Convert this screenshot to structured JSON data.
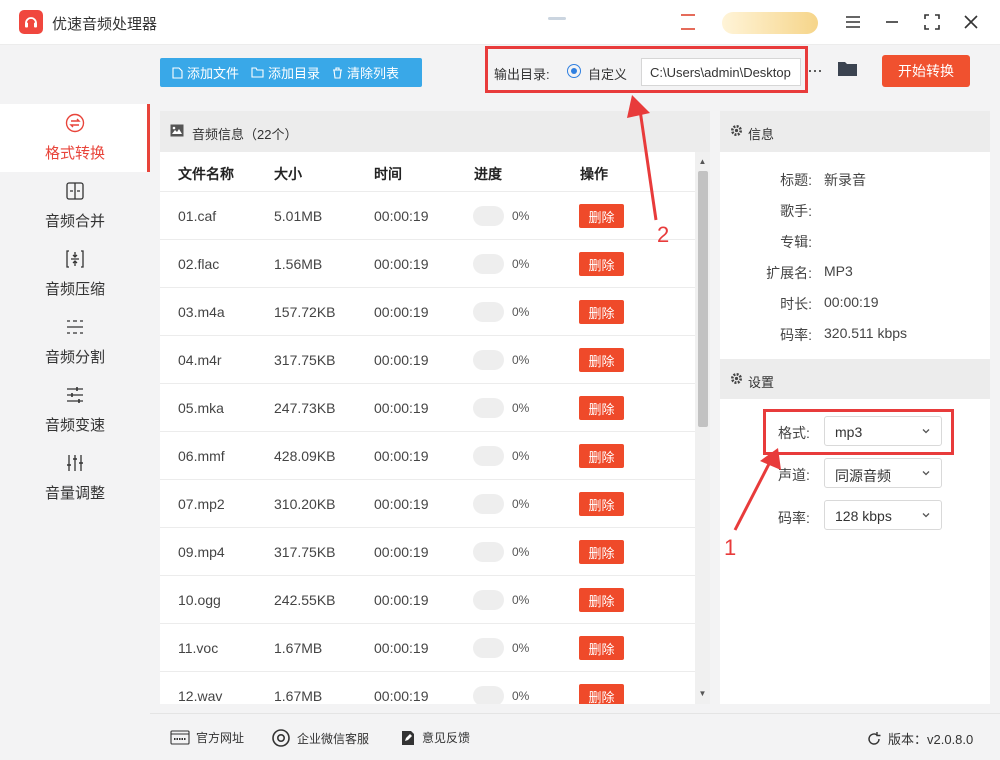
{
  "app": {
    "title": "优速音频处理器"
  },
  "sidebar": {
    "items": [
      {
        "label": "格式转换",
        "icon": "swap-icon",
        "active": true
      },
      {
        "label": "音频合并",
        "icon": "merge-icon",
        "active": false
      },
      {
        "label": "音频压缩",
        "icon": "compress-icon",
        "active": false
      },
      {
        "label": "音频分割",
        "icon": "split-icon",
        "active": false
      },
      {
        "label": "音频变速",
        "icon": "speed-icon",
        "active": false
      },
      {
        "label": "音量调整",
        "icon": "volume-icon",
        "active": false
      }
    ]
  },
  "toolbar": {
    "add_file": "添加文件",
    "add_folder": "添加目录",
    "clear_list": "清除列表"
  },
  "output": {
    "label": "输出目录:",
    "option": "自定义",
    "path": "C:\\Users\\admin\\Desktop",
    "more": "···"
  },
  "start_button": "开始转换",
  "list": {
    "title": "音频信息（22个）",
    "columns": [
      "文件名称",
      "大小",
      "时间",
      "进度",
      "操作"
    ],
    "rows": [
      {
        "name": "01.caf",
        "size": "5.01MB",
        "time": "00:00:19",
        "progress": "0%",
        "action": "删除"
      },
      {
        "name": "02.flac",
        "size": "1.56MB",
        "time": "00:00:19",
        "progress": "0%",
        "action": "删除"
      },
      {
        "name": "03.m4a",
        "size": "157.72KB",
        "time": "00:00:19",
        "progress": "0%",
        "action": "删除"
      },
      {
        "name": "04.m4r",
        "size": "317.75KB",
        "time": "00:00:19",
        "progress": "0%",
        "action": "删除"
      },
      {
        "name": "05.mka",
        "size": "247.73KB",
        "time": "00:00:19",
        "progress": "0%",
        "action": "删除"
      },
      {
        "name": "06.mmf",
        "size": "428.09KB",
        "time": "00:00:19",
        "progress": "0%",
        "action": "删除"
      },
      {
        "name": "07.mp2",
        "size": "310.20KB",
        "time": "00:00:19",
        "progress": "0%",
        "action": "删除"
      },
      {
        "name": "09.mp4",
        "size": "317.75KB",
        "time": "00:00:19",
        "progress": "0%",
        "action": "删除"
      },
      {
        "name": "10.ogg",
        "size": "242.55KB",
        "time": "00:00:19",
        "progress": "0%",
        "action": "删除"
      },
      {
        "name": "11.voc",
        "size": "1.67MB",
        "time": "00:00:19",
        "progress": "0%",
        "action": "删除"
      },
      {
        "name": "12.wav",
        "size": "1.67MB",
        "time": "00:00:19",
        "progress": "0%",
        "action": "删除"
      }
    ]
  },
  "info": {
    "title": "信息",
    "fields": [
      {
        "key": "标题:",
        "value": "新录音"
      },
      {
        "key": "歌手:",
        "value": ""
      },
      {
        "key": "专辑:",
        "value": ""
      },
      {
        "key": "扩展名:",
        "value": "MP3"
      },
      {
        "key": "时长:",
        "value": "00:00:19"
      },
      {
        "key": "码率:",
        "value": "320.511 kbps"
      }
    ]
  },
  "settings": {
    "title": "设置",
    "format_label": "格式:",
    "format_value": "mp3",
    "channel_label": "声道:",
    "channel_value": "同源音频",
    "bitrate_label": "码率:",
    "bitrate_value": "128 kbps"
  },
  "footer": {
    "website": "官方网址",
    "wechat": "企业微信客服",
    "feedback": "意见反馈",
    "version": "版本：v2.0.8.0"
  },
  "annotations": {
    "one": "1",
    "two": "2"
  },
  "colors": {
    "accent_red": "#e8443a",
    "toolbar_blue": "#39a8e8",
    "start_orange": "#f0512f"
  }
}
